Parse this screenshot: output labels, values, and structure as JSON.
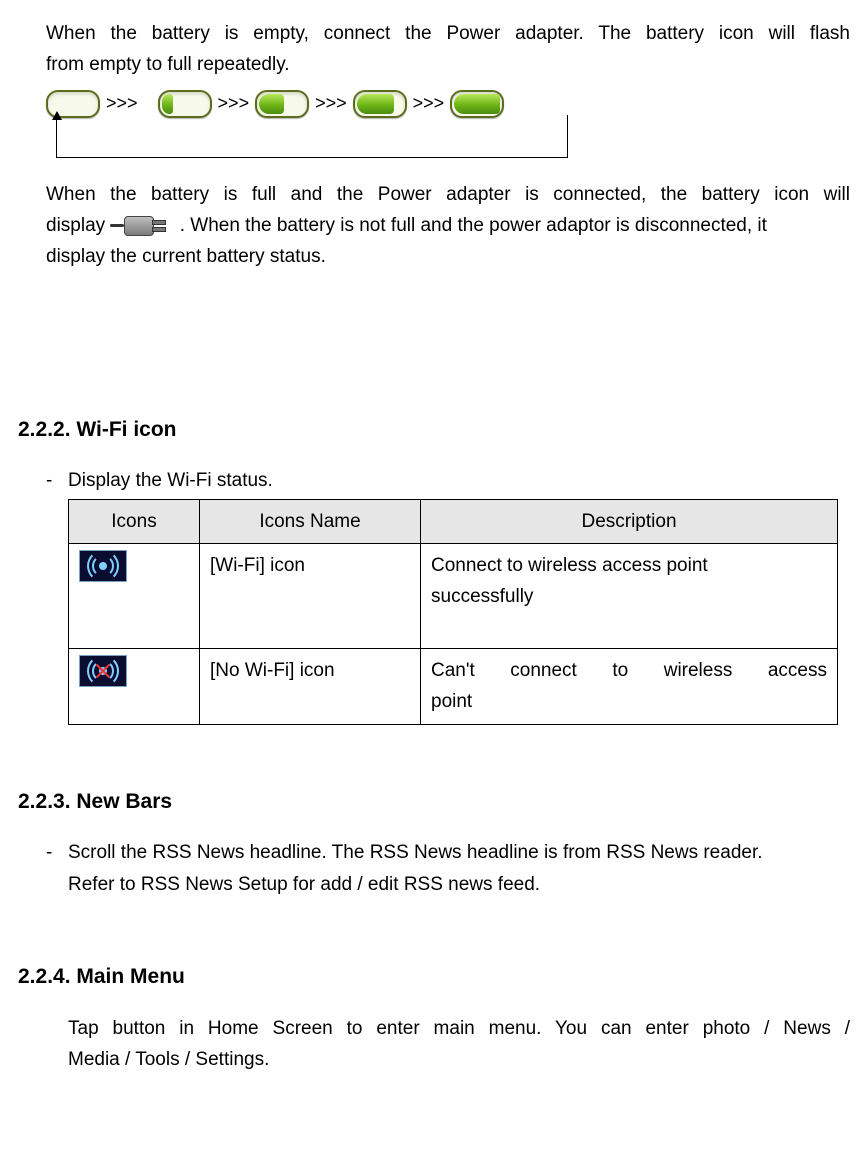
{
  "intro": {
    "p1_line1": "When the battery is empty, connect the Power adapter. The battery icon will flash",
    "p1_line2": "from empty to full repeatedly.",
    "sep": ">>>",
    "p2_line1": "When the battery is full and the Power adapter is connected, the battery icon will",
    "p2_line2a": "display ",
    "p2_line2b": ". When the battery is not full and the power adaptor is disconnected, it",
    "p2_line3": "display the current battery status."
  },
  "sec222": {
    "heading": "2.2.2. Wi-Fi icon",
    "bullet": "Display the Wi-Fi status.",
    "table": {
      "h1": "Icons",
      "h2": "Icons Name",
      "h3": "Description",
      "r1_name": "[Wi-Fi] icon",
      "r1_desc_l1": "Connect to wireless access point",
      "r1_desc_l2": "successfully",
      "r2_name": "[No Wi-Fi] icon",
      "r2_desc_l1": "Can't connect to wireless access",
      "r2_desc_l2": "point"
    }
  },
  "sec223": {
    "heading": "2.2.3. New Bars",
    "line1": "Scroll the RSS News headline. The RSS News headline is from RSS News reader.",
    "line2": "Refer to RSS News Setup for add / edit RSS news feed."
  },
  "sec224": {
    "heading": "2.2.4. Main Menu",
    "line1": "Tap   button in Home Screen to enter main menu. You can enter photo / News /",
    "line2": "Media / Tools / Settings."
  }
}
